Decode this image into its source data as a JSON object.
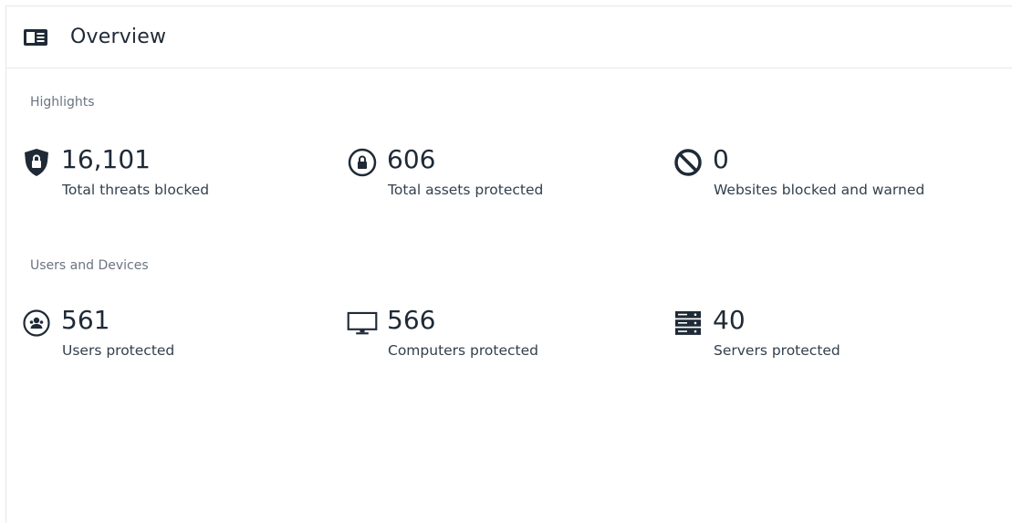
{
  "header": {
    "title": "Overview",
    "icon": "overview-card-icon"
  },
  "highlights": {
    "label": "Highlights",
    "items": [
      {
        "icon": "shield-lock-icon",
        "value": "16,101",
        "label": "Total threats blocked"
      },
      {
        "icon": "lock-circle-icon",
        "value": "606",
        "label": "Total assets protected"
      },
      {
        "icon": "blocked-icon",
        "value": "0",
        "label": "Websites blocked and warned"
      }
    ]
  },
  "users_devices": {
    "label": "Users and Devices",
    "items": [
      {
        "icon": "user-circle-icon",
        "value": "561",
        "label": "Users protected"
      },
      {
        "icon": "monitor-icon",
        "value": "566",
        "label": "Computers protected"
      },
      {
        "icon": "server-icon",
        "value": "40",
        "label": "Servers protected"
      }
    ]
  },
  "colors": {
    "text": "#1f2a36",
    "muted": "#6b7480",
    "icon": "#1f2a36",
    "border": "#e6e8eb"
  }
}
